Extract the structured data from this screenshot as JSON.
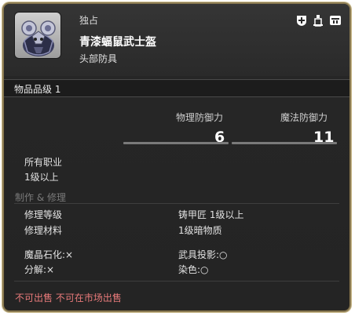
{
  "item": {
    "unique_label": "独占",
    "name": "青漆蝠鼠武士盔",
    "category": "头部防具",
    "item_level": "物品品级 1",
    "header_icons": [
      "crest-icon",
      "dye-bottle-icon",
      "armoire-icon"
    ]
  },
  "stats": {
    "physical_label": "物理防御力",
    "physical_value": "6",
    "magic_label": "魔法防御力",
    "magic_value": "11"
  },
  "requirements": {
    "jobs": "所有职业",
    "level": "1级以上"
  },
  "repair": {
    "section_title": "制作 & 修理",
    "repair_level_label": "修理等级",
    "repair_level_value": "铸甲匠 1级以上",
    "repair_material_label": "修理材料",
    "repair_material_value": "1级暗物质",
    "materia_label": "魔晶石化:×",
    "projection_label": "武具投影:○",
    "desynth_label": "分解:×",
    "dye_label": "染色:○"
  },
  "restrictions": {
    "text": "不可出售 不可在市场出售"
  }
}
